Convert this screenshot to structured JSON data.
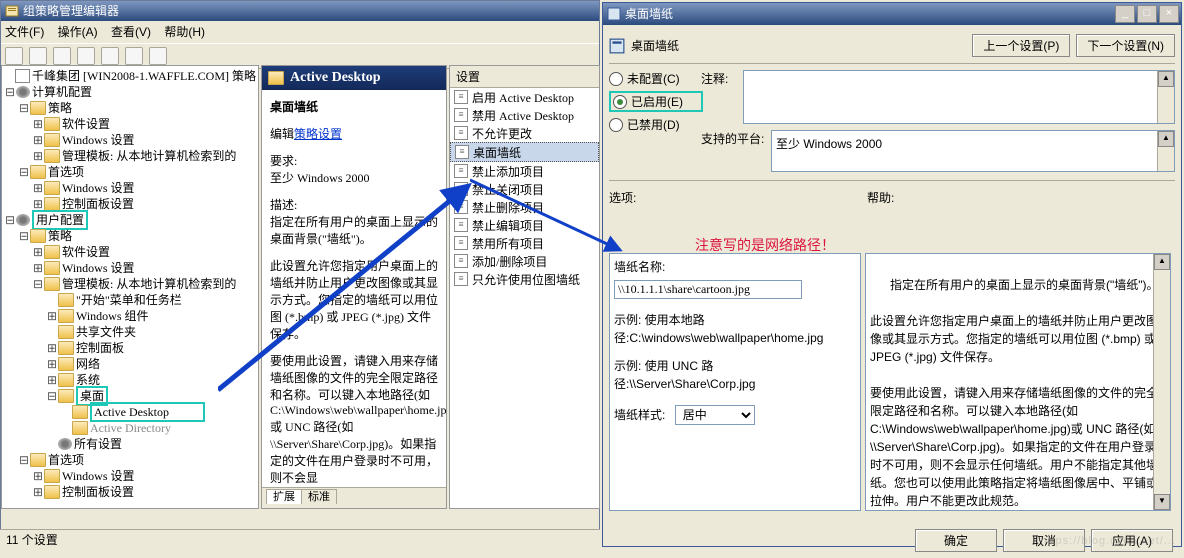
{
  "gpedit": {
    "title": "组策略管理编辑器",
    "menu": {
      "file": "文件(F)",
      "action": "操作(A)",
      "view": "查看(V)",
      "help": "帮助(H)"
    },
    "tree": {
      "root": "千峰集团 [WIN2008-1.WAFFLE.COM] 策略",
      "comp_cfg": "计算机配置",
      "policies": "策略",
      "sw": "软件设置",
      "win": "Windows 设置",
      "admintpl": "管理模板: 从本地计算机检索到的",
      "prefs": "首选项",
      "winset": "Windows 设置",
      "cpset": "控制面板设置",
      "user_cfg": "用户配置",
      "admintpl_user_items": {
        "startmenu": "\"开始\"菜单和任务栏",
        "wincomp": "Windows 组件",
        "shared": "共享文件夹",
        "cp": "控制面板",
        "network": "网络",
        "system": "系统",
        "desktop": "桌面",
        "active_desktop": "Active Desktop",
        "active_directory": "Active Directory",
        "allset": "所有设置"
      }
    },
    "desc": {
      "header": "Active Desktop",
      "title": "桌面墙纸",
      "editlink_label": "编辑",
      "editlink": "策略设置",
      "req_label": "要求:",
      "req": "至少 Windows 2000",
      "desc_label": "描述:",
      "desc_line1": "指定在所有用户的桌面上显示的桌面背景(\"墙纸\")。",
      "para2": "此设置允许您指定用户桌面上的墙纸并防止用户更改图像或其显示方式。您指定的墙纸可以用位图 (*.bmp) 或 JPEG (*.jpg) 文件保存。",
      "para3": "要使用此设置，请键入用来存储墙纸图像的文件的完全限定路径和名称。可以键入本地路径(如 C:\\Windows\\web\\wallpaper\\home.jpg)或 UNC 路径(如 \\\\Server\\Share\\Corp.jpg)。如果指定的文件在用户登录时不可用，则不会显"
    },
    "list": {
      "col": "设置",
      "items": [
        "启用 Active Desktop",
        "禁用 Active Desktop",
        "不允许更改",
        "桌面墙纸",
        "禁止添加项目",
        "禁止关闭项目",
        "禁止删除项目",
        "禁止编辑项目",
        "禁用所有项目",
        "添加/删除项目",
        "只允许使用位图墙纸"
      ],
      "selected_index": 3
    },
    "tabs": {
      "ext": "扩展",
      "std": "标准"
    },
    "status": "11 个设置"
  },
  "dialog": {
    "title": "桌面墙纸",
    "headicon_label": "桌面墙纸",
    "prev_btn": "上一个设置(P)",
    "next_btn": "下一个设置(N)",
    "radios": {
      "notconf": "未配置(C)",
      "enabled": "已启用(E)",
      "disabled": "已禁用(D)"
    },
    "comment_label": "注释:",
    "comment_value": "",
    "platform_label": "支持的平台:",
    "platform_value": "至少 Windows 2000",
    "options_label": "选项:",
    "help_label": "帮助:",
    "annotation_red": "注意写的是网络路径！",
    "wp_name_label": "墙纸名称:",
    "wp_name_value": "\\\\10.1.1.1\\share\\cartoon.jpg",
    "example_local_h": "示例: 使用本地路",
    "example_local_p": "径:C:\\windows\\web\\wallpaper\\home.jpg",
    "example_unc_h": "示例: 使用 UNC 路",
    "example_unc_p": "径:\\\\Server\\Share\\Corp.jpg",
    "wp_style_label": "墙纸样式:",
    "wp_style_value": "居中",
    "help_text": "指定在所有用户的桌面上显示的桌面背景(\"墙纸\")。\n\n此设置允许您指定用户桌面上的墙纸并防止用户更改图像或其显示方式。您指定的墙纸可以用位图 (*.bmp) 或 JPEG (*.jpg) 文件保存。\n\n要使用此设置，请键入用来存储墙纸图像的文件的完全限定路径和名称。可以键入本地路径(如 C:\\Windows\\web\\wallpaper\\home.jpg)或 UNC 路径(如 \\\\Server\\Share\\Corp.jpg)。如果指定的文件在用户登录时不可用，则不会显示任何墙纸。用户不能指定其他墙纸。您也可以使用此策略指定将墙纸图像居中、平铺或拉伸。用户不能更改此规范。\n\n如果未配置或禁用了此设置，则不会显示任何墙纸。",
    "ok": "确定",
    "cancel": "取消",
    "apply": "应用(A)"
  }
}
